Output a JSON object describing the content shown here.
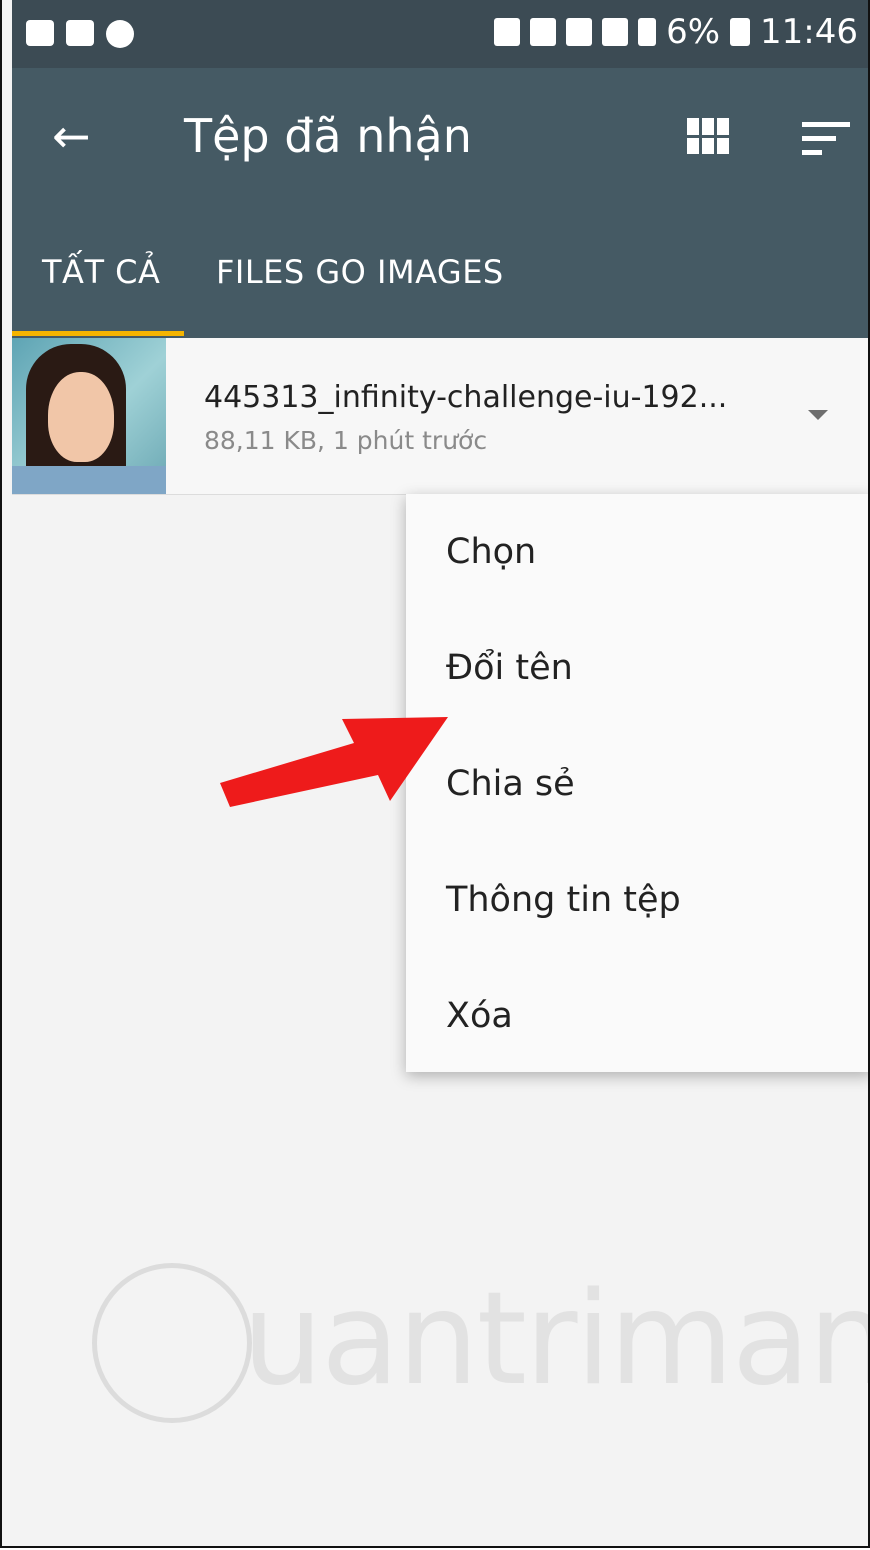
{
  "status_bar": {
    "left_icons": [
      "gallery-icon",
      "message-icon",
      "skype-icon"
    ],
    "right_icons": [
      "bluetooth-icon",
      "mute-icon",
      "alarm-icon",
      "wifi-icon",
      "signal-icon"
    ],
    "battery": "6%",
    "time": "11:46"
  },
  "app_bar": {
    "title": "Tệp đã nhận",
    "back_icon": "←",
    "actions": [
      "grid-view-icon",
      "sort-icon"
    ]
  },
  "tabs": [
    {
      "label": "TẤT CẢ",
      "active": true
    },
    {
      "label": "FILES GO IMAGES",
      "active": false
    }
  ],
  "file": {
    "name": "445313_infinity-challenge-iu-192...",
    "meta": "88,11 KB, 1 phút trước"
  },
  "menu": {
    "items": [
      "Chọn",
      "Đổi tên",
      "Chia sẻ",
      "Thông tin tệp",
      "Xóa"
    ]
  },
  "watermark": "uantrimang",
  "colors": {
    "app_bar": "#455a64",
    "status_bar": "#3c4b54",
    "tab_indicator": "#f5b400",
    "arrow": "#ee1b1b"
  }
}
